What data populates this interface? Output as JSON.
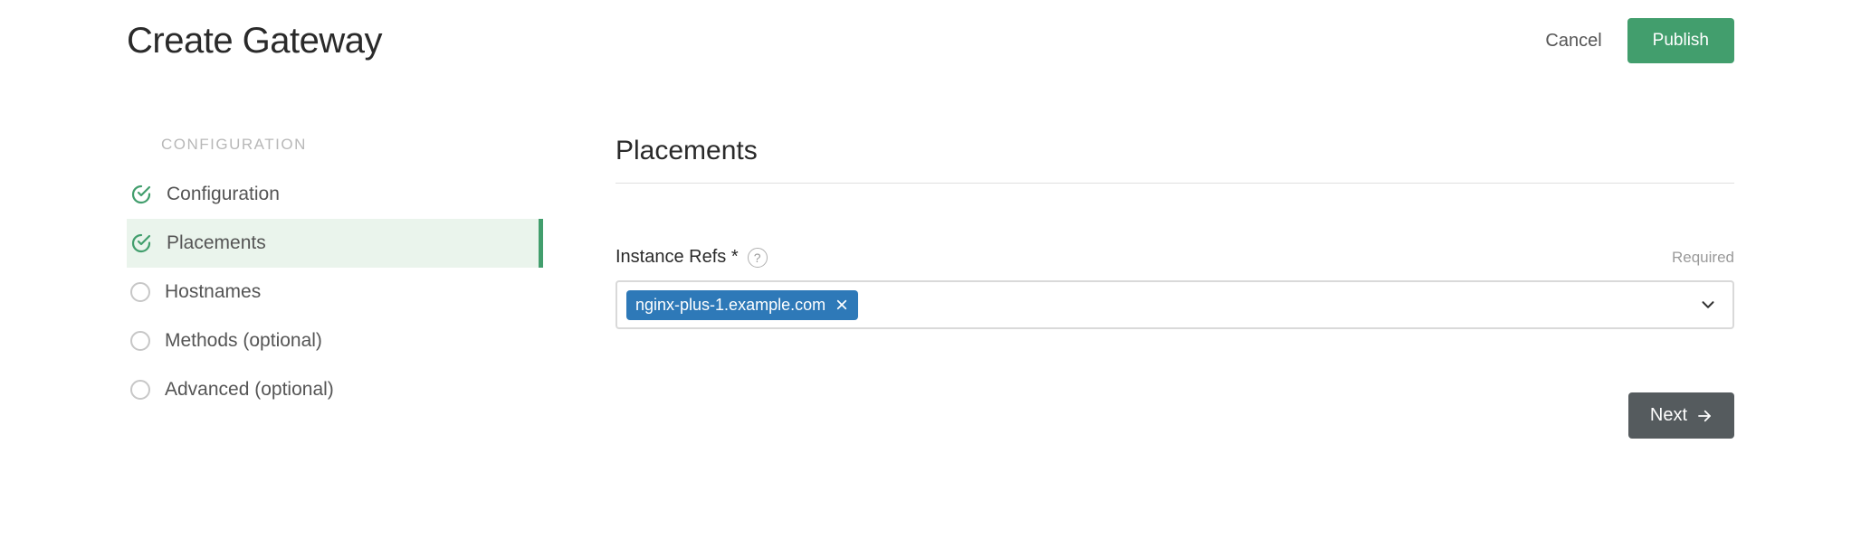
{
  "header": {
    "title": "Create Gateway",
    "cancel_label": "Cancel",
    "publish_label": "Publish"
  },
  "sidebar": {
    "heading": "CONFIGURATION",
    "steps": [
      {
        "label": "Configuration",
        "state": "completed"
      },
      {
        "label": "Placements",
        "state": "active"
      },
      {
        "label": "Hostnames",
        "state": "pending"
      },
      {
        "label": "Methods (optional)",
        "state": "pending"
      },
      {
        "label": "Advanced (optional)",
        "state": "pending"
      }
    ]
  },
  "main": {
    "section_title": "Placements",
    "field": {
      "label": "Instance Refs *",
      "help_icon": "?",
      "required_text": "Required",
      "chips": [
        {
          "label": "nginx-plus-1.example.com"
        }
      ]
    },
    "next_label": "Next"
  },
  "colors": {
    "accent_green": "#429e6d",
    "chip_blue": "#2e79b8",
    "next_gray": "#555b5e"
  }
}
